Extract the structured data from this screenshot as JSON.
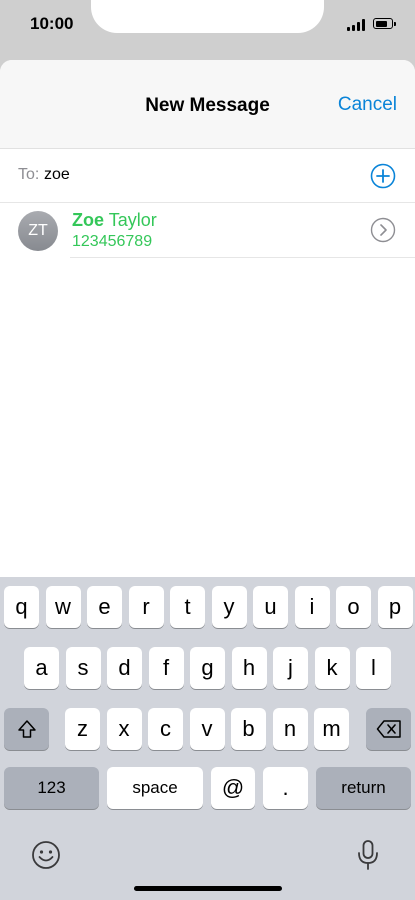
{
  "status": {
    "time": "10:00",
    "battery_level": 0.85,
    "signal_bars": 4
  },
  "nav": {
    "title": "New Message",
    "cancel_label": "Cancel"
  },
  "recipient": {
    "to_label": "To:",
    "value": "zoe"
  },
  "suggestion": {
    "initials": "ZT",
    "name_match": "Zoe",
    "name_rest": " Taylor",
    "number": "123456789"
  },
  "keyboard": {
    "row1": [
      "q",
      "w",
      "e",
      "r",
      "t",
      "y",
      "u",
      "i",
      "o",
      "p"
    ],
    "row2": [
      "a",
      "s",
      "d",
      "f",
      "g",
      "h",
      "j",
      "k",
      "l"
    ],
    "row3": [
      "z",
      "x",
      "c",
      "v",
      "b",
      "n",
      "m"
    ],
    "numbers_label": "123",
    "space_label": "space",
    "at_label": "@",
    "dot_label": ".",
    "return_label": "return"
  },
  "colors": {
    "accent": "#0a84d8",
    "match_green": "#34c759",
    "keyboard_bg": "#d1d4db"
  }
}
